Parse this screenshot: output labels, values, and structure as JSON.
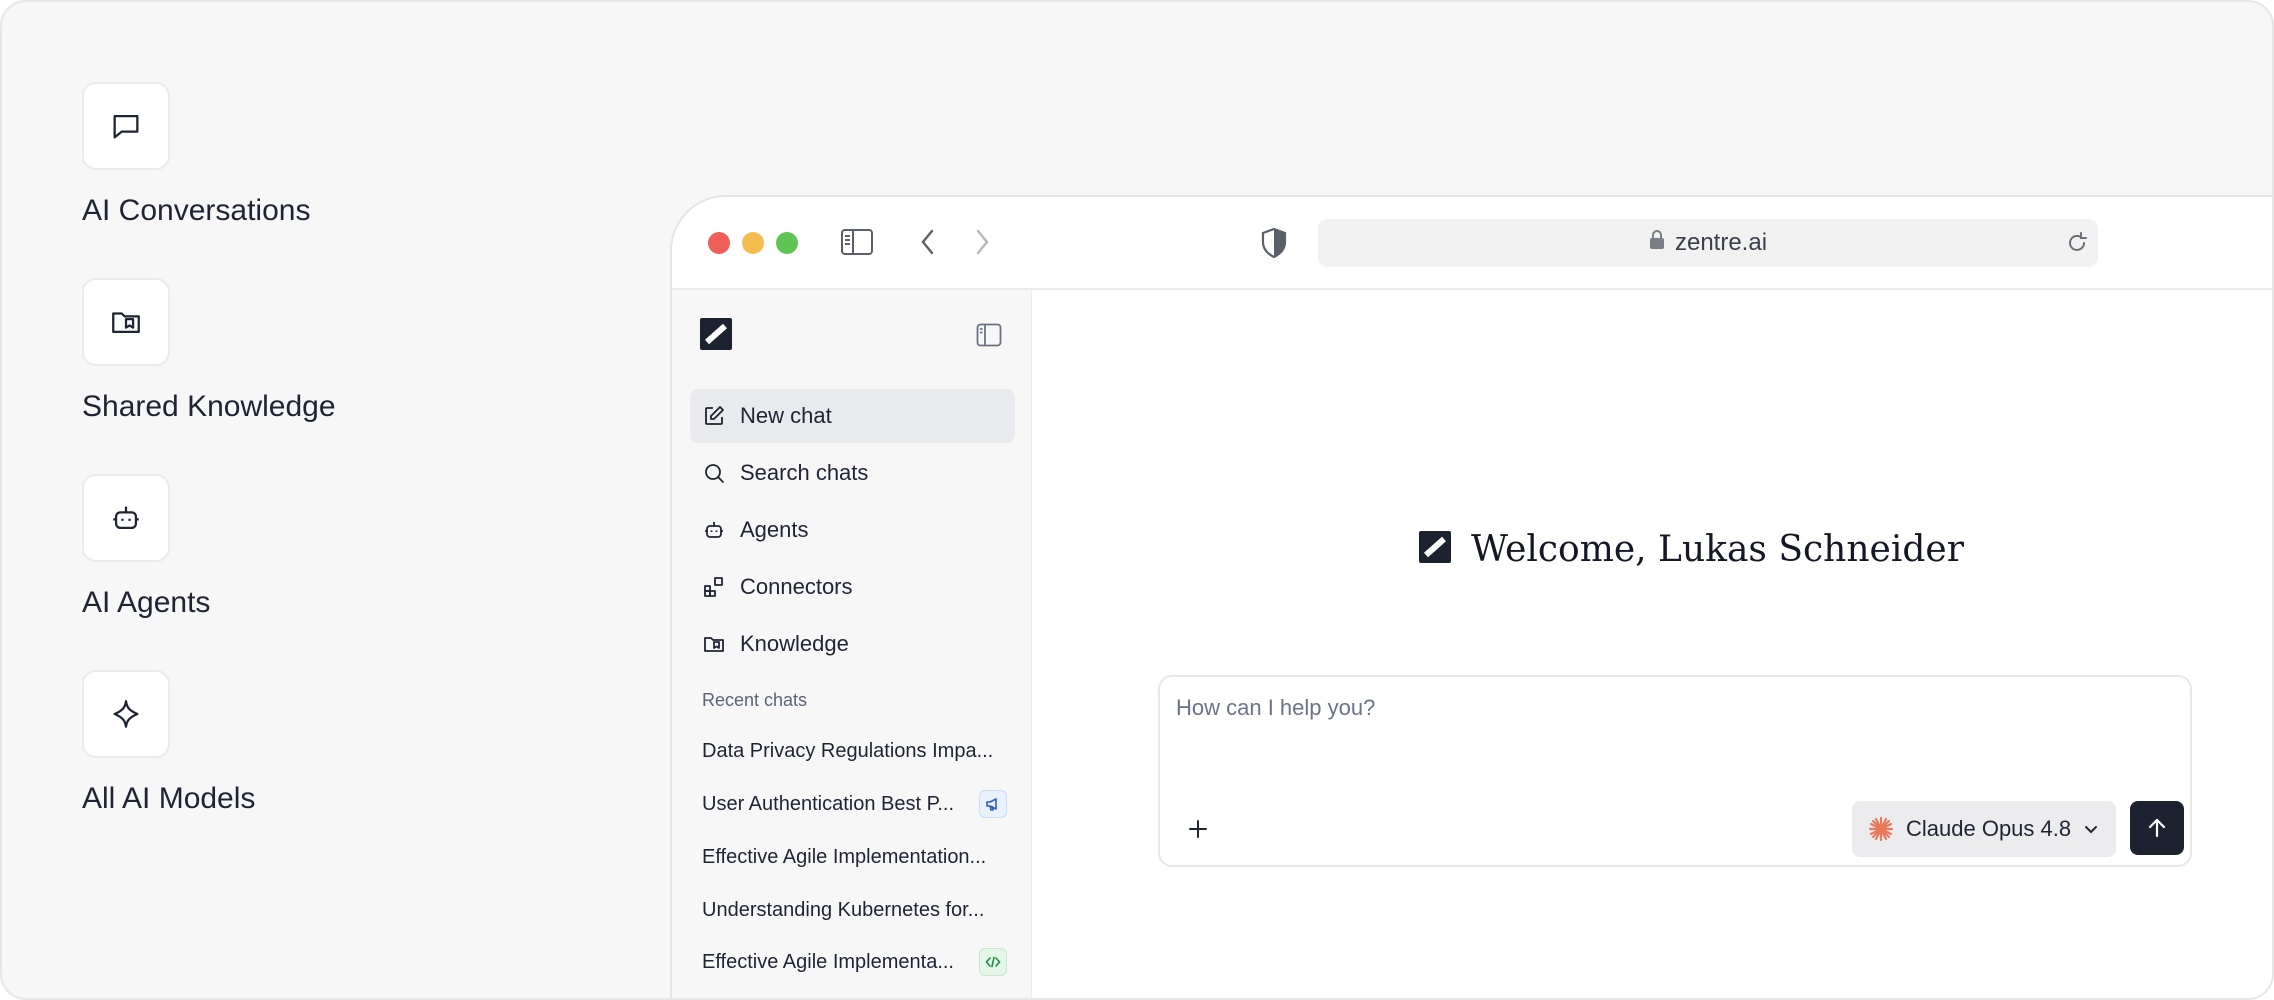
{
  "features": [
    {
      "label": "AI Conversations",
      "icon": "chat-bubble-icon"
    },
    {
      "label": "Shared Knowledge",
      "icon": "bookmark-folder-icon"
    },
    {
      "label": "AI Agents",
      "icon": "robot-icon"
    },
    {
      "label": "All AI Models",
      "icon": "sparkle-icon"
    }
  ],
  "browser": {
    "url": "zentre.ai"
  },
  "sidebar": {
    "nav": [
      {
        "label": "New chat",
        "icon": "edit-icon"
      },
      {
        "label": "Search chats",
        "icon": "search-icon"
      },
      {
        "label": "Agents",
        "icon": "robot-icon"
      },
      {
        "label": "Connectors",
        "icon": "connectors-icon"
      },
      {
        "label": "Knowledge",
        "icon": "bookmark-folder-icon"
      }
    ],
    "recent_title": "Recent chats",
    "recent": [
      {
        "title": "Data Privacy Regulations Impa...",
        "badge": ""
      },
      {
        "title": "User Authentication Best P...",
        "badge": "megaphone-icon"
      },
      {
        "title": "Effective Agile Implementation...",
        "badge": ""
      },
      {
        "title": "Understanding Kubernetes for...",
        "badge": ""
      },
      {
        "title": "Effective Agile Implementa...",
        "badge": "code-icon"
      }
    ]
  },
  "main": {
    "welcome": "Welcome, Lukas Schneider",
    "composer_placeholder": "How can I help you?",
    "model": "Claude Opus 4.8"
  },
  "colors": {
    "traffic_red": "#ee5f57",
    "traffic_yellow": "#f5bd4f",
    "traffic_green": "#5fc454",
    "brand_dark": "#1c2230",
    "model_accent": "#e8795a"
  }
}
